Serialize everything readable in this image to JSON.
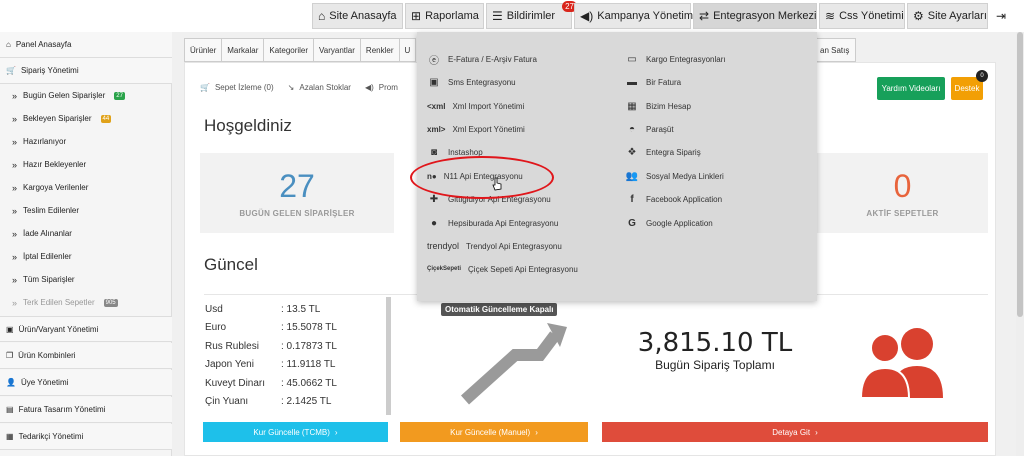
{
  "topnav": {
    "items": [
      {
        "label": "Site Anasayfa",
        "icon": "home-icon"
      },
      {
        "label": "Raporlama",
        "icon": "chart-icon"
      },
      {
        "label": "Bildirimler",
        "icon": "list-icon",
        "badge": "27"
      },
      {
        "label": "Kampanya Yönetimi",
        "icon": "megaphone-icon"
      },
      {
        "label": "Entegrasyon Merkezi",
        "icon": "exchange-icon"
      },
      {
        "label": "Css Yönetimi",
        "icon": "layers-icon"
      },
      {
        "label": "Site Ayarları",
        "icon": "gear-icon"
      }
    ]
  },
  "sidebar": {
    "items": [
      {
        "label": "Panel Anasayfa",
        "icon": "home-icon",
        "type": "main"
      },
      {
        "label": "Sipariş Yönetimi",
        "icon": "cart-icon",
        "type": "main"
      },
      {
        "label": "Bugün Gelen Siparişler",
        "badge": "27",
        "badge_color": "#2aa34a",
        "type": "sub"
      },
      {
        "label": "Bekleyen Siparişler",
        "badge": "44",
        "badge_color": "#e0a21a",
        "type": "sub"
      },
      {
        "label": "Hazırlanıyor",
        "type": "sub"
      },
      {
        "label": "Hazır Bekleyenler",
        "type": "sub"
      },
      {
        "label": "Kargoya Verilenler",
        "type": "sub"
      },
      {
        "label": "Teslim Edilenler",
        "type": "sub"
      },
      {
        "label": "İade Alınanlar",
        "type": "sub"
      },
      {
        "label": "İptal Edilenler",
        "type": "sub"
      },
      {
        "label": "Tüm Siparişler",
        "type": "sub"
      },
      {
        "label": "Terk Edilen Sepetler",
        "badge": "905",
        "badge_color": "#888888",
        "type": "sub",
        "dim": true
      },
      {
        "label": "Ürün/Varyant Yönetimi",
        "icon": "box-icon",
        "type": "main"
      },
      {
        "label": "Ürün Kombinleri",
        "icon": "copy-icon",
        "type": "main"
      },
      {
        "label": "Üye Yönetimi",
        "icon": "user-icon",
        "type": "main"
      },
      {
        "label": "Fatura Tasarım Yönetimi",
        "icon": "file-icon",
        "type": "main"
      },
      {
        "label": "Tedarikçi Yönetimi",
        "icon": "truck-icon",
        "type": "main"
      }
    ]
  },
  "tabs": [
    "Ürünler",
    "Markalar",
    "Kategoriler",
    "Varyantlar",
    "Renkler",
    "U"
  ],
  "tab_right": "an Satış",
  "quickbar": [
    "Sepet İzleme (0)",
    "Azalan Stoklar",
    "Prom"
  ],
  "buttons": {
    "videos": "Yardım Videoları",
    "support": "Destek",
    "support_badge": "0"
  },
  "welcome": "Hoşgeldiniz",
  "stats": {
    "today_value": "27",
    "today_label": "BUGÜN GELEN SİPARİŞLER",
    "today_color": "#4a8fc0",
    "cart_value": "0",
    "cart_label": "AKTİF SEPETLER",
    "cart_color": "#e8643c"
  },
  "current_title": "Güncel",
  "currencies": [
    {
      "name": "Usd",
      "value": ": 13.5 TL"
    },
    {
      "name": "Euro",
      "value": ": 15.5078 TL"
    },
    {
      "name": "Rus Rublesi",
      "value": ": 0.17873 TL"
    },
    {
      "name": "Japon Yeni",
      "value": ": 11.9118 TL"
    },
    {
      "name": "Kuveyt Dinarı",
      "value": ": 45.0662 TL"
    },
    {
      "name": "Çin Yuanı",
      "value": ": 2.1425 TL"
    }
  ],
  "auto_update": "Otomatik Güncelleme Kapalı",
  "total": {
    "value": "3,815.10 TL",
    "label": "Bugün Sipariş Toplamı"
  },
  "bottom_buttons": [
    {
      "label": "Kur Güncelle (TCMB)",
      "color": "#1ec0ea"
    },
    {
      "label": "Kur Güncelle (Manuel)",
      "color": "#f29a1f"
    },
    {
      "label": "Detaya Git",
      "color": "#df4c3b"
    }
  ],
  "dropdown": {
    "left": [
      {
        "label": "E-Fatura / E-Arşiv Fatura",
        "icon": "invoice-icon"
      },
      {
        "label": "Sms Entegrasyonu",
        "icon": "sms-icon"
      },
      {
        "label": "Xml Import Yönetimi",
        "icon": "xml-import-icon",
        "icon_text": "<xml"
      },
      {
        "label": "Xml Export Yönetimi",
        "icon": "xml-export-icon",
        "icon_text": "xml>"
      },
      {
        "label": "Instashop",
        "icon": "instagram-icon"
      },
      {
        "label": "N11 Api Entegrasyonu",
        "icon": "n11-icon",
        "icon_text": "n"
      },
      {
        "label": "Gittigidiyor Api Entegrasyonu",
        "icon": "gittigidiyor-icon"
      },
      {
        "label": "Hepsiburada Api Entegrasyonu",
        "icon": "hepsiburada-icon"
      },
      {
        "label": "Trendyol Api Entegrasyonu",
        "icon": "trendyol-icon",
        "icon_text": "trendyol"
      },
      {
        "label": "Çiçek Sepeti Api Entegrasyonu",
        "icon": "ciceksepeti-icon",
        "icon_text": "ÇiçekSepeti"
      }
    ],
    "right": [
      {
        "label": "Kargo Entegrasyonları",
        "icon": "cargo-icon"
      },
      {
        "label": "Bir Fatura",
        "icon": "truck-icon"
      },
      {
        "label": "Bizim Hesap",
        "icon": "calculator-icon"
      },
      {
        "label": "Paraşüt",
        "icon": "parachute-icon"
      },
      {
        "label": "Entegra Sipariş",
        "icon": "entegra-icon"
      },
      {
        "label": "Sosyal Medya Linkleri",
        "icon": "users-icon"
      },
      {
        "label": "Facebook Application",
        "icon": "facebook-icon"
      },
      {
        "label": "Google Application",
        "icon": "google-icon"
      }
    ]
  }
}
